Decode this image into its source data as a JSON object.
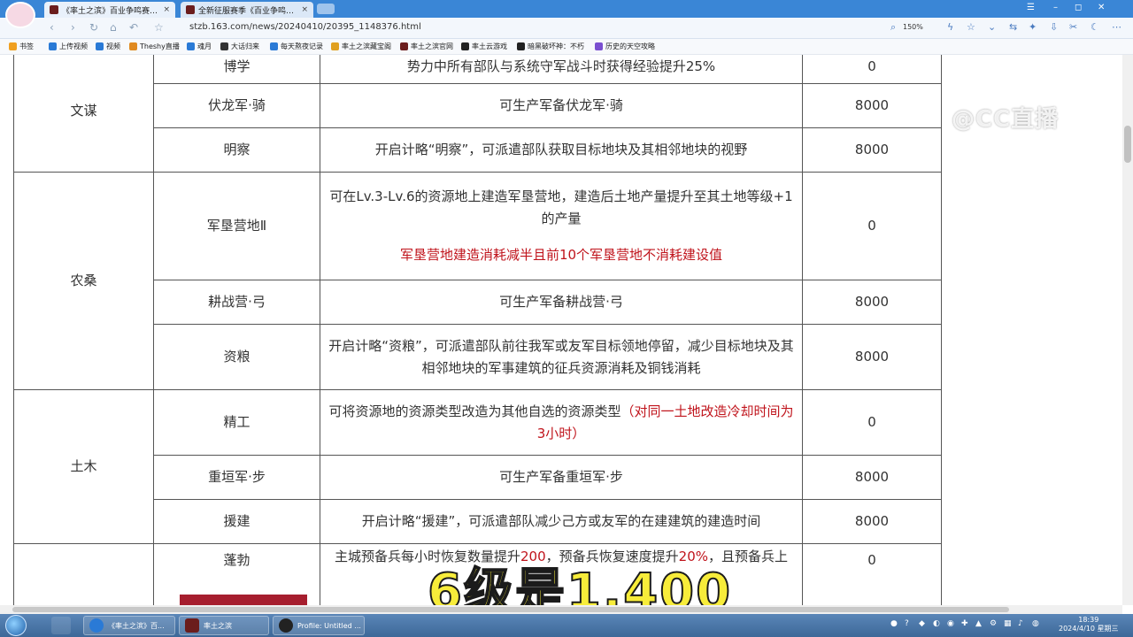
{
  "browser": {
    "tabs": [
      {
        "label": "《率土之滨》百业争鸣赛季玩法",
        "close": "×"
      },
      {
        "label": "全新征服赛季《百业争鸣》赛季",
        "close": "×"
      }
    ],
    "url": "stzb.163.com/news/20240410/20395_1148376.html",
    "zoom": "150%",
    "window_controls": [
      "☰",
      "–",
      "◻",
      "✕"
    ]
  },
  "bookmarks": [
    {
      "label": "书签",
      "color": "#f0a020"
    },
    {
      "label": "上传视频",
      "color": "#2a7ad6"
    },
    {
      "label": "视频",
      "color": "#2a7ad6"
    },
    {
      "label": "Theshy直播",
      "color": "#e08a20"
    },
    {
      "label": "魂月",
      "color": "#2a7ad6"
    },
    {
      "label": "大话归来",
      "color": "#333333"
    },
    {
      "label": "每天熬夜记录",
      "color": "#2a7ad6"
    },
    {
      "label": "率土之滨藏宝阁",
      "color": "#e0a020"
    },
    {
      "label": "率土之滨官网",
      "color": "#6b1d1d"
    },
    {
      "label": "率土云游戏",
      "color": "#222222"
    },
    {
      "label": "暗黑破坏神：不朽",
      "color": "#222222"
    },
    {
      "label": "历史的天空攻略",
      "color": "#7a4fd0"
    }
  ],
  "table": {
    "rows": [
      {
        "cat": "",
        "name": "博学",
        "desc": "势力中所有部队与系统守军战斗时获得经验提升25%",
        "val": "0",
        "val_red": true
      },
      {
        "cat": "文谋",
        "name": "伏龙军·骑",
        "desc": "可生产军备伏龙军·骑",
        "val": "8000",
        "val_red": false
      },
      {
        "cat": "",
        "name": "明察",
        "desc": "开启计略“明察”，可派遣部队获取目标地块及其相邻地块的视野",
        "val": "8000",
        "val_red": false
      },
      {
        "cat": "农桑",
        "name": "军垦营地Ⅱ",
        "desc": "可在Lv.3-Lv.6的资源地上建造军垦营地，建造后土地产量提升至其土地等级+1的产量",
        "note": "军垦营地建造消耗减半且前10个军垦营地不消耗建设值",
        "val": "0",
        "val_red": true
      },
      {
        "cat": "",
        "name": "耕战营·弓",
        "desc": "可生产军备耕战营·弓",
        "val": "8000",
        "val_red": false
      },
      {
        "cat": "",
        "name": "资粮",
        "desc": "开启计略“资粮”，可派遣部队前往我军或友军目标领地停留，减少目标地块及其相邻地块的军事建筑的征兵资源消耗及铜钱消耗",
        "val": "8000",
        "val_red": false
      },
      {
        "cat": "土木",
        "name": "精工",
        "desc": "可将资源地的资源类型改造为其他自选的资源类型",
        "desc_red": "（对同一土地改造冷却时间为3小时）",
        "val": "0",
        "val_red": true
      },
      {
        "cat": "",
        "name": "重垣军·步",
        "desc": "可生产军备重垣军·步",
        "val": "8000",
        "val_red": false
      },
      {
        "cat": "",
        "name": "援建",
        "desc": "开启计略“援建”，可派遣部队减少己方或友军的在建建筑的建造时间",
        "val": "8000",
        "val_red": false
      },
      {
        "cat": "",
        "name": "蓬勃",
        "desc_a": "主城预备兵每小时恢复数量提升",
        "desc_b": "200",
        "desc_c": "，预备兵恢复速度提升",
        "desc_d": "20%",
        "desc_e": "，且预备兵上",
        "val": "0",
        "val_red": true
      }
    ]
  },
  "overlay": {
    "watermark": "@CC直播",
    "subtitle": "6级是1,400"
  },
  "taskbar": {
    "apps": [
      {
        "label": "《率土之滨》百...",
        "color": "#2a7ad6"
      },
      {
        "label": "率土之滨",
        "color": "#6b1d1d"
      },
      {
        "label": "Profile: Untitled ...",
        "color": "#222222"
      }
    ],
    "time": "18:39",
    "date": "2024/4/10 星期三"
  }
}
